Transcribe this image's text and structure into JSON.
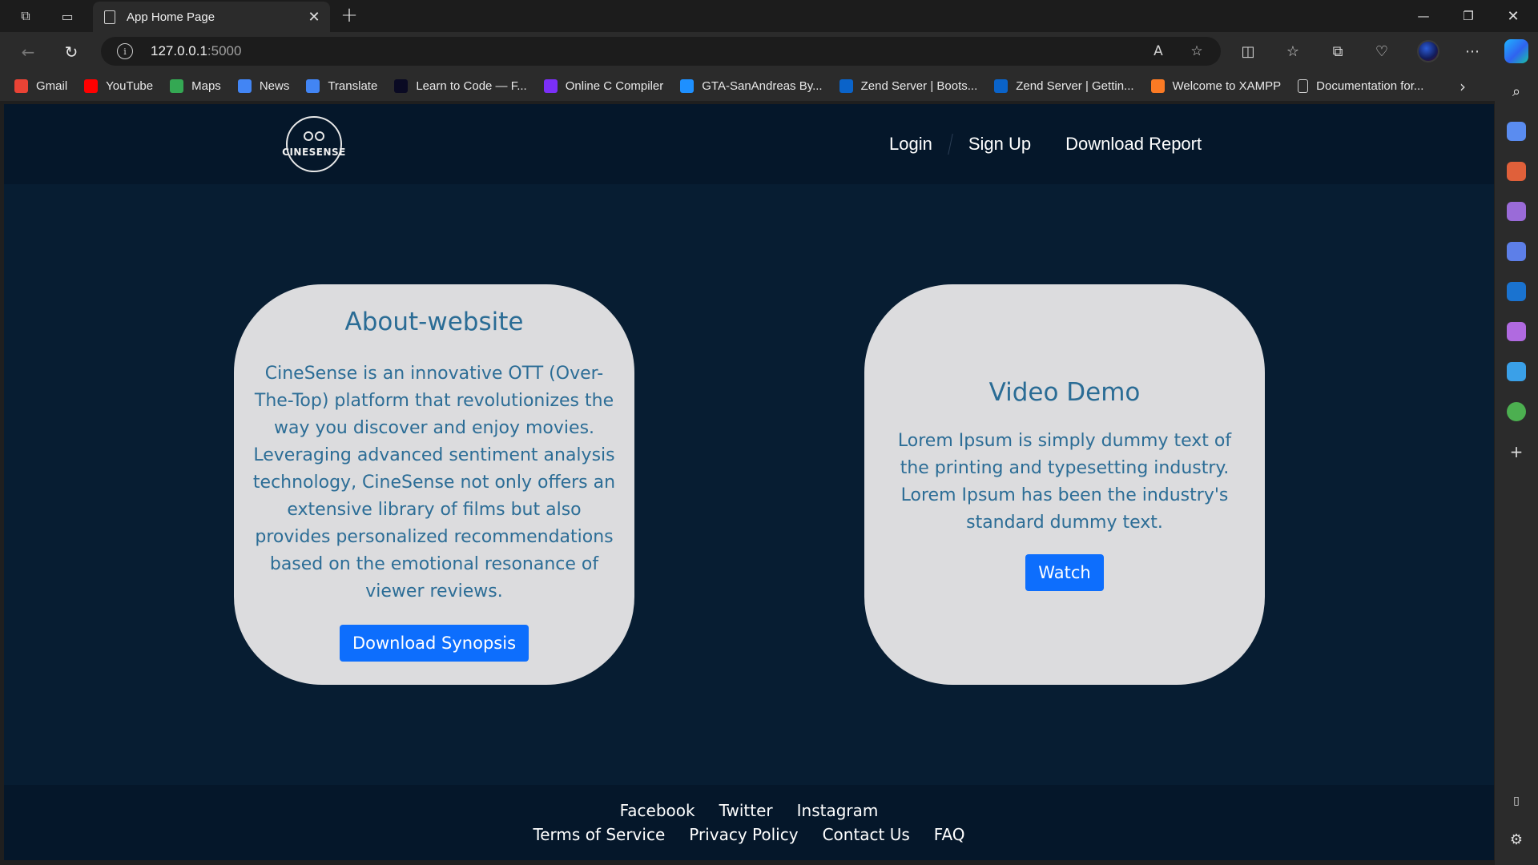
{
  "browser": {
    "tab_title": "App Home Page",
    "url_host": "127.0.0.1",
    "url_port": ":5000",
    "bookmarks": [
      {
        "label": "Gmail",
        "icon": "gmail-icon",
        "color": "#ea4335"
      },
      {
        "label": "YouTube",
        "icon": "youtube-icon",
        "color": "#ff0000"
      },
      {
        "label": "Maps",
        "icon": "maps-icon",
        "color": "#34a853"
      },
      {
        "label": "News",
        "icon": "news-icon",
        "color": "#4285f4"
      },
      {
        "label": "Translate",
        "icon": "translate-icon",
        "color": "#4285f4"
      },
      {
        "label": "Learn to Code — F...",
        "icon": "freecodecamp-icon",
        "color": "#0a0a23"
      },
      {
        "label": "Online C Compiler",
        "icon": "compiler-icon",
        "color": "#7b2ff7"
      },
      {
        "label": "GTA-SanAndreas By...",
        "icon": "gta-icon",
        "color": "#1e90ff"
      },
      {
        "label": "Zend Server | Boots...",
        "icon": "zend-icon",
        "color": "#0a63c9"
      },
      {
        "label": "Zend Server | Gettin...",
        "icon": "zend-icon",
        "color": "#0a63c9"
      },
      {
        "label": "Welcome to XAMPP",
        "icon": "xampp-icon",
        "color": "#fb7a24"
      },
      {
        "label": "Documentation for...",
        "icon": "document-icon",
        "color": "#2b2b2b"
      }
    ]
  },
  "site": {
    "logo_text": "CINESENSE",
    "nav": {
      "login": "Login",
      "signup": "Sign Up",
      "download_report": "Download Report"
    },
    "about_card": {
      "title": "About-website",
      "body": "CineSense is an innovative OTT (Over-The-Top) platform that revolutionizes the way you discover and enjoy movies. Leveraging advanced sentiment analysis technology, CineSense not only offers an extensive library of films but also provides personalized recommendations based on the emotional resonance of viewer reviews.",
      "button": "Download Synopsis"
    },
    "video_card": {
      "title": "Video Demo",
      "body": "Lorem Ipsum is simply dummy text of the printing and typesetting industry. Lorem Ipsum has been the industry's standard dummy text.",
      "button": "Watch"
    },
    "footer": {
      "social": [
        "Facebook",
        "Twitter",
        "Instagram"
      ],
      "links": [
        "Terms of Service",
        "Privacy Policy",
        "Contact Us",
        "FAQ"
      ]
    }
  }
}
